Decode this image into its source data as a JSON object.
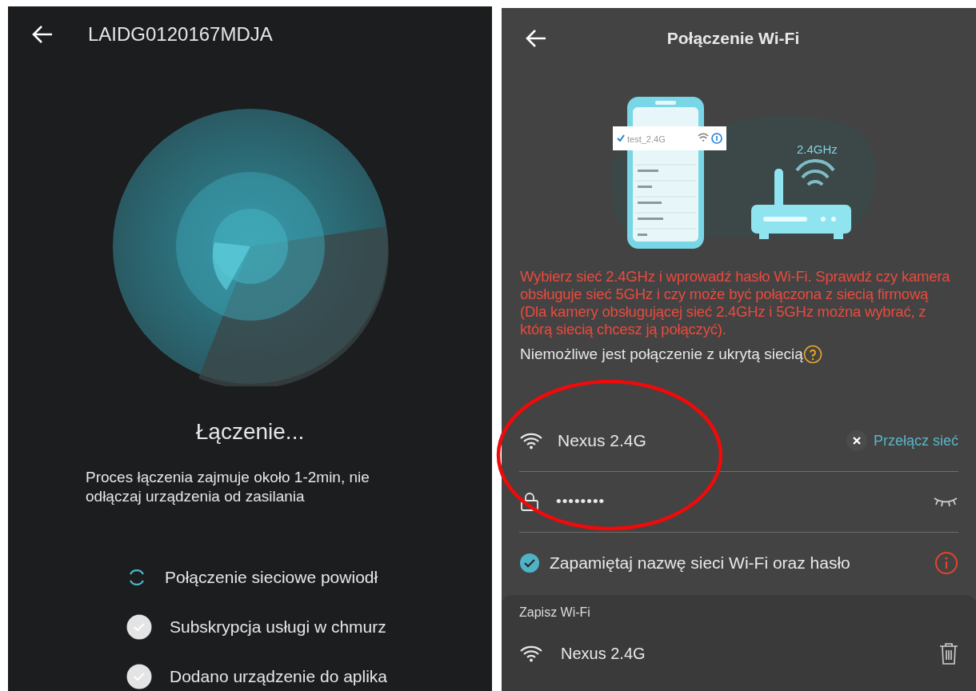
{
  "left_screen": {
    "title": "LAIDG0120167MDJA",
    "status": "Łączenie...",
    "description": "Proces łączenia zajmuje około 1-2min, nie odłączaj urządzenia od zasilania",
    "steps": [
      {
        "kind": "spinner",
        "label": "Połączenie sieciowe powiodł"
      },
      {
        "kind": "done",
        "label": "Subskrypcja usługi w chmurz"
      },
      {
        "kind": "done",
        "label": "Dodano urządzenie do aplika"
      }
    ]
  },
  "right_screen": {
    "title": "Połączenie Wi-Fi",
    "illustration": {
      "network_label": "test_2.4G",
      "band_label": "2.4GHz"
    },
    "warning": "Wybierz sieć 2.4GHz i wprowadź hasło Wi-Fi. Sprawdź czy kamera obsługuje sieć 5GHz i czy może być połączona z siecią firmową (Dla kamery obsługującej sieć 2.4GHz i 5GHz można wybrać, z którą siecią chcesz ją połączyć).",
    "note": "Niemożliwe jest połączenie z ukrytą siecią",
    "network": {
      "name": "Nexus 2.4G",
      "switch_link": "Przełącz sieć"
    },
    "password": {
      "value": "••••••••"
    },
    "remember": {
      "label": "Zapamiętaj nazwę sieci Wi-Fi oraz hasło",
      "checked": true
    },
    "saved": {
      "title": "Zapisz Wi-Fi",
      "items": [
        {
          "name": "Nexus 2.4G"
        }
      ]
    }
  }
}
